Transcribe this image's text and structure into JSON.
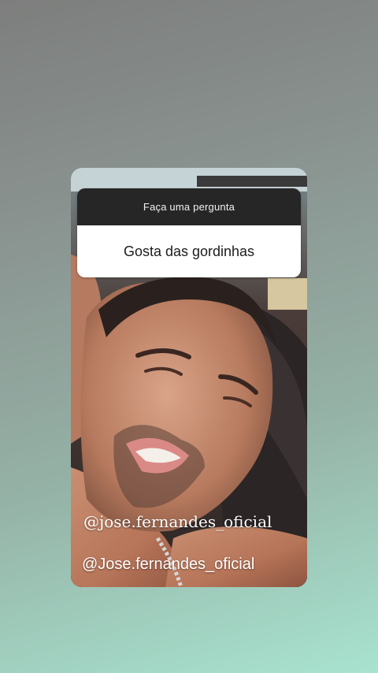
{
  "question_sticker": {
    "prompt": "Faça uma pergunta",
    "answer": "Gosta das gordinhas"
  },
  "overlay_texts": {
    "handle_serif": "@jose.fernandes_oficial",
    "handle_sans": "@Jose.fernandes_oficial"
  },
  "colors": {
    "header_bg": "#262626",
    "answer_bg": "#ffffff",
    "background_top": "#7d7e7d",
    "background_bottom": "#a8e3cf"
  }
}
